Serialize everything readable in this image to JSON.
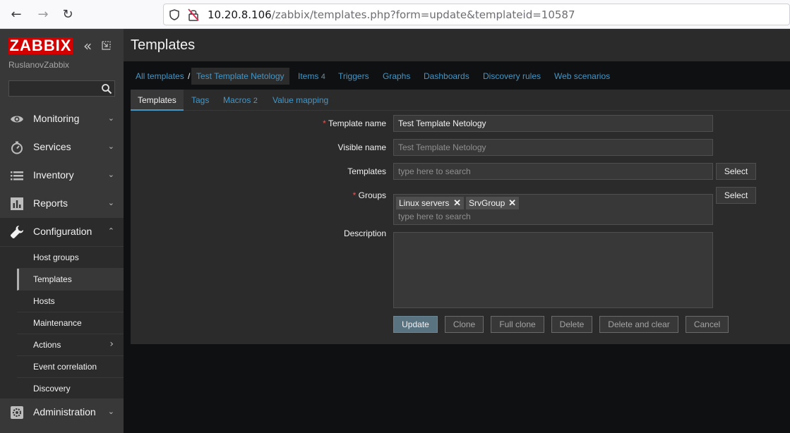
{
  "browser": {
    "url_host": "10.20.8.106",
    "url_path": "/zabbix/templates.php?form=update&templateid=10587"
  },
  "sidebar": {
    "logo": "ZABBIX",
    "server_name": "RuslanovZabbix",
    "menu": [
      {
        "label": "Monitoring",
        "icon": "eye-icon"
      },
      {
        "label": "Services",
        "icon": "stopwatch-icon"
      },
      {
        "label": "Inventory",
        "icon": "list-icon"
      },
      {
        "label": "Reports",
        "icon": "bar-chart-icon"
      },
      {
        "label": "Configuration",
        "icon": "wrench-icon"
      },
      {
        "label": "Administration",
        "icon": "gear-icon"
      }
    ],
    "submenu": [
      {
        "label": "Host groups"
      },
      {
        "label": "Templates"
      },
      {
        "label": "Hosts"
      },
      {
        "label": "Maintenance"
      },
      {
        "label": "Actions"
      },
      {
        "label": "Event correlation"
      },
      {
        "label": "Discovery"
      }
    ]
  },
  "main": {
    "title": "Templates",
    "breadcrumbs": {
      "all_templates": "All templates",
      "separator": "/",
      "current": "Test Template Netology",
      "items_label": "Items",
      "items_count": "4",
      "triggers": "Triggers",
      "graphs": "Graphs",
      "dashboards": "Dashboards",
      "discovery_rules": "Discovery rules",
      "web_scenarios": "Web scenarios"
    },
    "tabs": {
      "templates": "Templates",
      "tags": "Tags",
      "macros_label": "Macros",
      "macros_count": "2",
      "value_mapping": "Value mapping"
    },
    "form": {
      "required_mark": "*",
      "template_name_label": "Template name",
      "template_name_value": "Test Template Netology",
      "visible_name_label": "Visible name",
      "visible_name_placeholder": "Test Template Netology",
      "templates_label": "Templates",
      "templates_placeholder": "type here to search",
      "groups_label": "Groups",
      "groups": [
        "Linux servers",
        "SrvGroup"
      ],
      "groups_placeholder": "type here to search",
      "description_label": "Description",
      "select_label": "Select"
    },
    "actions": {
      "update": "Update",
      "clone": "Clone",
      "full_clone": "Full clone",
      "delete": "Delete",
      "delete_and_clear": "Delete and clear",
      "cancel": "Cancel"
    }
  }
}
